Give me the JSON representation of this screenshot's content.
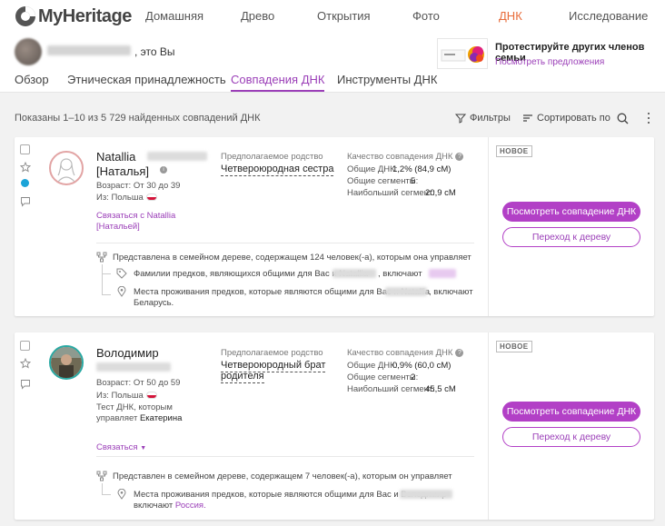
{
  "brand": {
    "name": "MyHeritage"
  },
  "nav": [
    {
      "label": "Домашняя"
    },
    {
      "label": "Древо"
    },
    {
      "label": "Открытия"
    },
    {
      "label": "Фото"
    },
    {
      "label": "ДНК",
      "active": true
    },
    {
      "label": "Исследование"
    }
  ],
  "profile": {
    "suffix": ", это Вы"
  },
  "promo": {
    "title": "Протестируйте других членов семьи",
    "link": "Посмотреть предложения"
  },
  "tabs": [
    {
      "label": "Обзор"
    },
    {
      "label": "Этническая принадлежность"
    },
    {
      "label": "Совпадения ДНК",
      "active": true
    },
    {
      "label": "Инструменты ДНК"
    }
  ],
  "results": {
    "summary": "Показаны 1–10 из 5 729 найденных совпадений ДНК",
    "filters_label": "Фильтры",
    "sort_label": "Сортировать по"
  },
  "matches": [
    {
      "first_name": "Natallia",
      "alt_name": "[Наталья]",
      "age": "Возраст: От 30 до 39",
      "from": "Из: Польша",
      "contact": "Связаться с Natallia",
      "contact_alt": "[Натальей]",
      "relation_label": "Предполагаемое родство",
      "relation": "Четвероюродная сестра",
      "quality_label": "Качество совпадения ДНК",
      "shared_dna_label": "Общие ДНК:",
      "shared_dna": "1,2% (84,9 сМ)",
      "shared_segments_label": "Общие сегменты:",
      "shared_segments": "5",
      "largest_segment_label": "Наибольший сегмент:",
      "largest_segment": "20,9 сМ",
      "badge": "НОВОЕ",
      "view_button": "Посмотреть совпадение ДНК",
      "tree_button": "Переход к дереву",
      "tree_info": "Представлена в семейном дереве, содержащем 124 человек(-а), которым она управляет",
      "surnames": "Фамилии предков, являющихся общими для Вас и Natallia",
      "surnames_suffix": ", включают",
      "places": "Места проживания предков, которые являются общими для Вас и Natallia",
      "places_suffix": ", включают",
      "places_value": "Беларусь."
    },
    {
      "first_name": "Володимир",
      "age": "Возраст: От 50 до 59",
      "from": "Из: Польша",
      "managed_1": "Тест ДНК, которым",
      "managed_2": "управляет",
      "managed_name": "Екатерина",
      "contact": "Связаться",
      "relation_label": "Предполагаемое родство",
      "relation_1": "Четвероюродный брат",
      "relation_2": "родителя",
      "quality_label": "Качество совпадения ДНК",
      "shared_dna_label": "Общие ДНК:",
      "shared_dna": "0,9% (60,0 сМ)",
      "shared_segments_label": "Общие сегменты:",
      "shared_segments": "2",
      "largest_segment_label": "Наибольший сегмент:",
      "largest_segment": "45,5 сМ",
      "badge": "НОВОЕ",
      "view_button": "Посмотреть совпадение ДНК",
      "tree_button": "Переход к дереву",
      "tree_info": "Представлен в семейном дереве, содержащем 7 человек(-а), которым он управляет",
      "places": "Места проживания предков, которые являются общими для Вас и Володимир",
      "places_suffix": "включают",
      "places_value": "Россия."
    }
  ],
  "colors": {
    "accent": "#b240c6",
    "active_nav": "#e86c3a",
    "link": "#9b3fb8",
    "online_dot": "#1ba4d8"
  }
}
